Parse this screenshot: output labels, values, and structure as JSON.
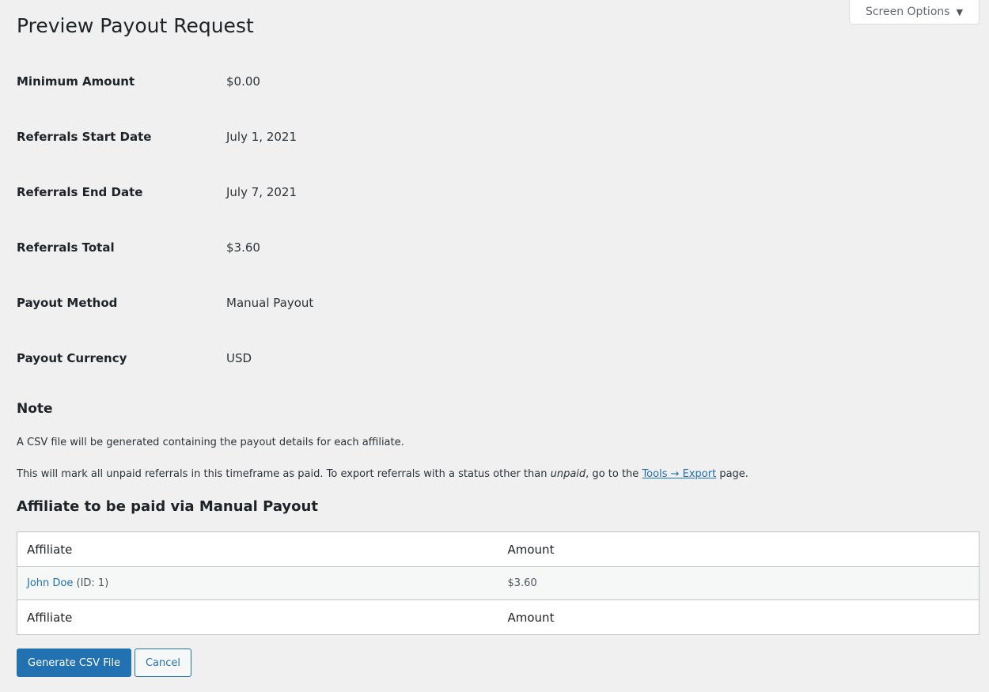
{
  "screen_options": {
    "label": "Screen Options",
    "caret": "▼"
  },
  "page_title": "Preview Payout Request",
  "details": [
    {
      "label": "Minimum Amount",
      "value": "$0.00"
    },
    {
      "label": "Referrals Start Date",
      "value": "July 1, 2021"
    },
    {
      "label": "Referrals End Date",
      "value": "July 7, 2021"
    },
    {
      "label": "Referrals Total",
      "value": "$3.60"
    },
    {
      "label": "Payout Method",
      "value": "Manual Payout"
    },
    {
      "label": "Payout Currency",
      "value": "USD"
    }
  ],
  "note": {
    "heading": "Note",
    "line1": "A CSV file will be generated containing the payout details for each affiliate.",
    "line2_before": "This will mark all unpaid referrals in this timeframe as paid. To export referrals with a status other than ",
    "line2_em": "unpaid",
    "line2_mid": ", go to the ",
    "line2_link": "Tools → Export",
    "line2_after": " page."
  },
  "affiliates": {
    "heading": "Affiliate to be paid via Manual Payout",
    "columns": [
      "Affiliate",
      "Amount"
    ],
    "rows": [
      {
        "name": "John Doe",
        "id_text": " (ID: 1)",
        "amount": "$3.60"
      }
    ]
  },
  "actions": {
    "generate": "Generate CSV File",
    "cancel": "Cancel"
  },
  "colors": {
    "primary": "#2271b1",
    "background": "#f0f0f1"
  }
}
